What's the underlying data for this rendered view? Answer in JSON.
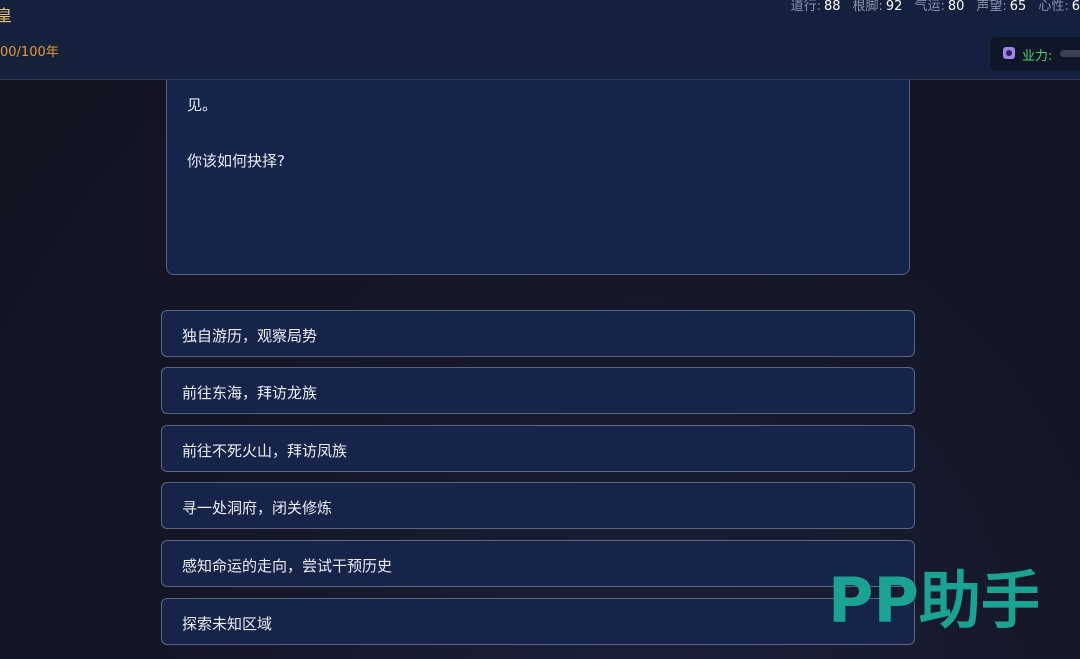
{
  "header": {
    "title_fragment": "皇",
    "stats": [
      {
        "label": "道行:",
        "value": "88"
      },
      {
        "label": "根脚:",
        "value": "92"
      },
      {
        "label": "气运:",
        "value": "80"
      },
      {
        "label": "声望:",
        "value": "65"
      },
      {
        "label": "心性:",
        "value": "6"
      }
    ],
    "years": "00/100年",
    "karma_label": "业力:",
    "karma_level": 0
  },
  "story": {
    "line_1": "见。",
    "line_2": "你该如何抉择?"
  },
  "choices": [
    {
      "label": "独自游历，观察局势"
    },
    {
      "label": "前往东海，拜访龙族"
    },
    {
      "label": "前往不死火山，拜访凤族"
    },
    {
      "label": "寻一处洞府，闭关修炼"
    },
    {
      "label": "感知命运的走向，尝试干预历史"
    },
    {
      "label": "探索未知区域"
    }
  ],
  "watermark": {
    "text": "PP助手",
    "color": "#1aa392"
  },
  "colors": {
    "accent_gold": "#e8c06a",
    "accent_orange": "#e8963c",
    "karma_green": "#4bd66a",
    "panel_blue": "#15244a"
  },
  "icons": {
    "karma": "karma-swirl-icon"
  }
}
